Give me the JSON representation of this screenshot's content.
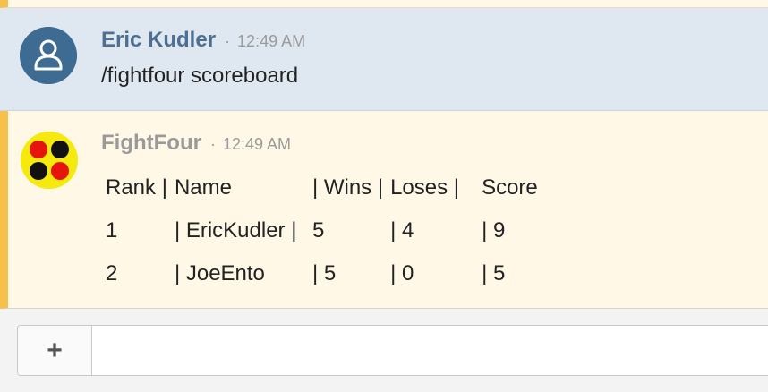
{
  "messages": [
    {
      "author": "Eric Kudler",
      "separator": "·",
      "time": "12:49 AM",
      "text": "/fightfour scoreboard",
      "avatar_icon": "user-silhouette-icon"
    },
    {
      "author": "FightFour",
      "separator": "·",
      "time": "12:49 AM",
      "avatar_icon": "four-dots-icon",
      "table": {
        "headers": [
          "Rank |",
          "Name",
          "| Wins |",
          "Loses |",
          "Score"
        ],
        "rows": [
          [
            "1",
            "| EricKudler |",
            "5",
            "| 4",
            "| 9"
          ],
          [
            "2",
            "| JoeEnto",
            "| 5",
            "| 0",
            "| 5"
          ]
        ]
      }
    }
  ],
  "composer": {
    "add_button": "+",
    "input_value": "",
    "input_placeholder": ""
  },
  "colors": {
    "eric_bg": "#dfe8f1",
    "bot_bg": "#fff8e6",
    "accent": "#f7c04a",
    "author_blue": "#4d6f92"
  }
}
